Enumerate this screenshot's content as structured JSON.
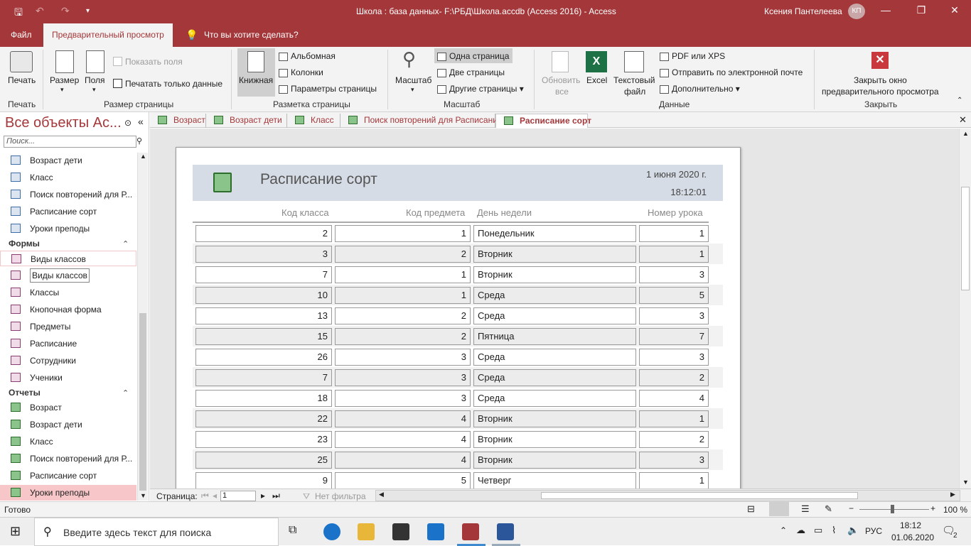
{
  "titlebar": {
    "title": "Школа : база данных- F:\\РБД\\Школа.accdb (Access 2016)  -  Access",
    "user": "Ксения Пантелеева",
    "user_initials": "КП",
    "minimize": "—",
    "restore": "❐",
    "close": "✕"
  },
  "ribbon_tabs": {
    "file": "Файл",
    "preview": "Предварительный просмотр",
    "tell_me": "Что вы хотите сделать?"
  },
  "ribbon": {
    "print": "Печать",
    "size": "Размер",
    "margins": "Поля",
    "show_margins": "Показать поля",
    "print_data_only": "Печатать только данные",
    "portrait": "Книжная",
    "landscape": "Альбомная",
    "columns": "Колонки",
    "page_setup": "Параметры страницы",
    "zoom": "Масштаб",
    "one_page": "Одна страница",
    "two_pages": "Две страницы",
    "more_pages": "Другие страницы",
    "refresh_all_1": "Обновить",
    "refresh_all_2": "все",
    "excel": "Excel",
    "text_file_1": "Текстовый",
    "text_file_2": "файл",
    "pdf_xps": "PDF или XPS",
    "email": "Отправить по электронной почте",
    "more": "Дополнительно",
    "close_preview_1": "Закрыть окно",
    "close_preview_2": "предварительного просмотра",
    "groups": {
      "print": "Печать",
      "page_size": "Размер страницы",
      "page_layout": "Разметка страницы",
      "zoom": "Масштаб",
      "data": "Данные",
      "close": "Закрыть"
    }
  },
  "nav": {
    "title": "Все объекты Ac...",
    "search_placeholder": "Поиск...",
    "queries": [
      "Возраст дети",
      "Класс",
      "Поиск повторений для Р...",
      "Расписание сорт",
      "Уроки преподы"
    ],
    "forms_header": "Формы",
    "forms": [
      "Виды классов",
      "Виды классов",
      "Классы",
      "Кнопочная форма",
      "Предметы",
      "Расписание",
      "Сотрудники",
      "Ученики"
    ],
    "reports_header": "Отчеты",
    "reports": [
      "Возраст",
      "Возраст дети",
      "Класс",
      "Поиск повторений для Р...",
      "Расписание сорт",
      "Уроки преподы"
    ]
  },
  "doc_tabs": [
    "Возраст",
    "Возраст дети",
    "Класс",
    "Поиск повторений для Расписание",
    "Расписание сорт"
  ],
  "report": {
    "title": "Расписание сорт",
    "date": "1 июня 2020 г.",
    "time": "18:12:01",
    "columns": [
      "Код класса",
      "Код предмета",
      "День недели",
      "Номер урока"
    ],
    "rows": [
      [
        "2",
        "1",
        "Понедельник",
        "1"
      ],
      [
        "3",
        "2",
        "Вторник",
        "1"
      ],
      [
        "7",
        "1",
        "Вторник",
        "3"
      ],
      [
        "10",
        "1",
        "Среда",
        "5"
      ],
      [
        "13",
        "2",
        "Среда",
        "3"
      ],
      [
        "15",
        "2",
        "Пятница",
        "7"
      ],
      [
        "26",
        "3",
        "Среда",
        "3"
      ],
      [
        "7",
        "3",
        "Среда",
        "2"
      ],
      [
        "18",
        "3",
        "Среда",
        "4"
      ],
      [
        "22",
        "4",
        "Вторник",
        "1"
      ],
      [
        "23",
        "4",
        "Вторник",
        "2"
      ],
      [
        "25",
        "4",
        "Вторник",
        "3"
      ],
      [
        "9",
        "5",
        "Четверг",
        "1"
      ]
    ]
  },
  "record_nav": {
    "page_label": "Страница:",
    "page_value": "1",
    "filter": "Нет фильтра"
  },
  "status": {
    "ready": "Готово",
    "zoom": "100 %"
  },
  "taskbar": {
    "search_placeholder": "Введите здесь текст для поиска",
    "lang": "РУС",
    "time": "18:12",
    "date": "01.06.2020",
    "notifications": "2"
  },
  "colors": {
    "accent": "#a4373a",
    "report_header": "#d6dce5"
  }
}
